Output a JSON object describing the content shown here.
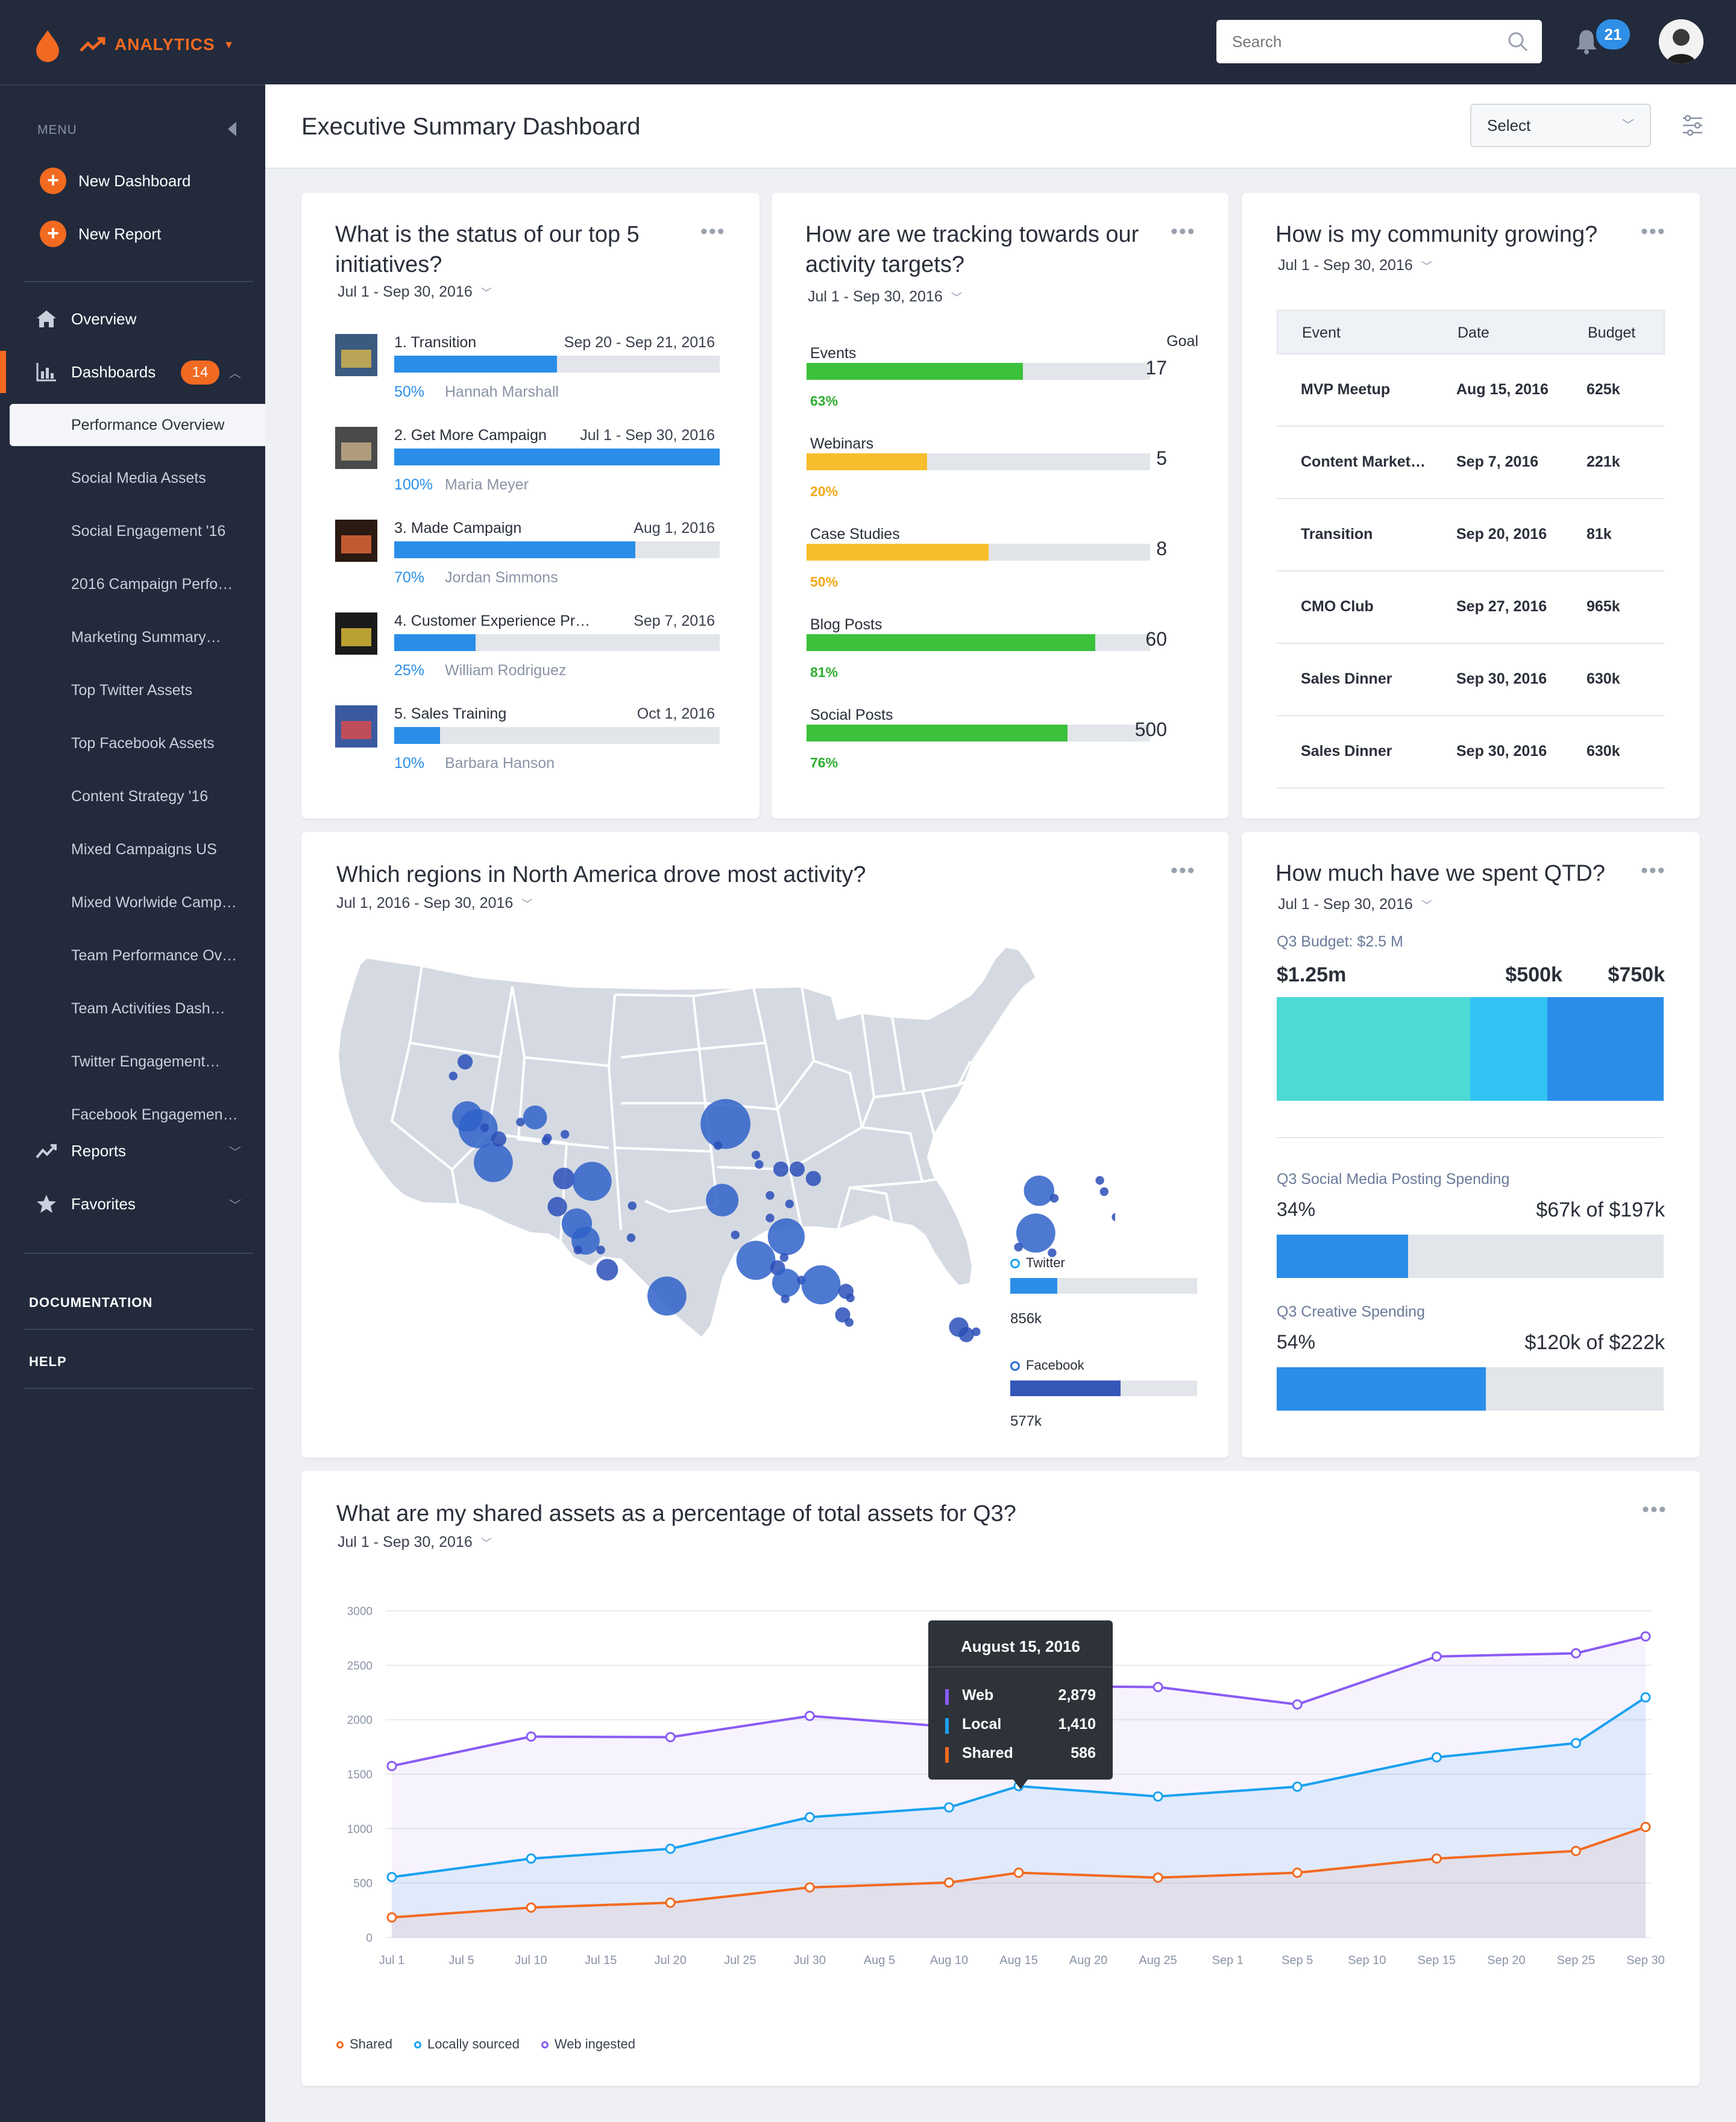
{
  "topbar": {
    "app_name": "ANALYTICS",
    "search": {
      "placeholder": "Search"
    },
    "notifications": "21"
  },
  "sidebar": {
    "menu_label": "MENU",
    "actions": [
      "New Dashboard",
      "New Report"
    ],
    "items": [
      {
        "label": "Overview",
        "icon": "home-icon"
      },
      {
        "label": "Dashboards",
        "icon": "bar-chart-icon",
        "badge": "14",
        "expanded": true
      },
      {
        "label": "Reports",
        "icon": "trend-icon"
      },
      {
        "label": "Favorites",
        "icon": "star-icon"
      }
    ],
    "dashboards": [
      "Performance Overview",
      "Social Media Assets",
      "Social Engagement '16",
      "2016 Campaign Perfo…",
      "Marketing Summary…",
      "Top Twitter Assets",
      "Top Facebook Assets",
      "Content Strategy '16",
      "Mixed Campaigns US",
      "Mixed Worlwide Camp…",
      "Team Performance Ov…",
      "Team Activities Dash…",
      "Twitter Engagement…",
      "Facebook Engagemen…"
    ],
    "sections": [
      "DOCUMENTATION",
      "HELP"
    ]
  },
  "header": {
    "title": "Executive Summary Dashboard",
    "select": "Select"
  },
  "initiatives": {
    "title": "What is the status of our top 5 initiatives?",
    "date": "Jul 1 - Sep 30, 2016",
    "rows": [
      {
        "name": "1. Transition",
        "date": "Sep 20 - Sep 21, 2016",
        "pct": "50%",
        "value": 0.5,
        "owner": "Hannah Marshall"
      },
      {
        "name": "2. Get More Campaign",
        "date": "Jul 1 - Sep 30, 2016",
        "pct": "100%",
        "value": 1.0,
        "owner": "Maria Meyer"
      },
      {
        "name": "3. Made Campaign",
        "date": "Aug 1, 2016",
        "pct": "70%",
        "value": 0.74,
        "owner": "Jordan Simmons"
      },
      {
        "name": "4. Customer Experience Pr…",
        "date": "Sep 7, 2016",
        "pct": "25%",
        "value": 0.25,
        "owner": "William Rodriguez"
      },
      {
        "name": "5. Sales Training",
        "date": "Oct 1, 2016",
        "pct": "10%",
        "value": 0.14,
        "owner": "Barbara Hanson"
      }
    ]
  },
  "activity": {
    "title": "How are we tracking towards our activity targets?",
    "date": "Jul 1 - Sep 30, 2016",
    "goal_label": "Goal",
    "rows": [
      {
        "name": "Events",
        "pct": "63%",
        "value": 0.63,
        "goal": "17",
        "color": "#3cc13c"
      },
      {
        "name": "Webinars",
        "pct": "20%",
        "value": 0.35,
        "goal": "5",
        "color": "#f7bd2c"
      },
      {
        "name": "Case Studies",
        "pct": "50%",
        "value": 0.53,
        "goal": "8",
        "color": "#f7bd2c"
      },
      {
        "name": "Blog Posts",
        "pct": "81%",
        "value": 0.84,
        "goal": "60",
        "color": "#3cc13c"
      },
      {
        "name": "Social Posts",
        "pct": "76%",
        "value": 0.76,
        "goal": "500",
        "color": "#3cc13c"
      }
    ]
  },
  "community": {
    "title": "How is my community growing?",
    "date": "Jul 1 - Sep 30, 2016",
    "columns": [
      "Event",
      "Date",
      "Budget"
    ],
    "rows": [
      [
        "MVP Meetup",
        "Aug 15, 2016",
        "625k"
      ],
      [
        "Content Market…",
        "Sep 7, 2016",
        "221k"
      ],
      [
        "Transition",
        "Sep 20, 2016",
        "81k"
      ],
      [
        "CMO Club",
        "Sep 27, 2016",
        "965k"
      ],
      [
        "Sales Dinner",
        "Sep 30, 2016",
        "630k"
      ],
      [
        "Sales Dinner",
        "Sep 30, 2016",
        "630k"
      ]
    ]
  },
  "regions": {
    "title": "Which regions in North America drove most activity?",
    "date": "Jul 1, 2016 - Sep 30, 2016",
    "legend": [
      {
        "name": "Twitter",
        "value": "856k",
        "fill": 0.25,
        "color": "#2a8ee8"
      },
      {
        "name": "Facebook",
        "value": "577k",
        "fill": 0.59,
        "color": "#3557b8"
      }
    ]
  },
  "spent": {
    "title": "How much have we spent QTD?",
    "date": "Jul 1 - Sep 30, 2016",
    "budget_label": "Q3 Budget: $2.5 M",
    "segments": [
      {
        "label": "$1.25m",
        "value": 1.25,
        "color": "#4dd9d4"
      },
      {
        "label": "$500k",
        "value": 0.5,
        "color": "#31c4f3"
      },
      {
        "label": "$750k",
        "value": 0.75,
        "color": "#2a8ee8"
      }
    ],
    "social": {
      "label": "Q3 Social Media Posting Spending",
      "pct": "34%",
      "amount": "$67k of $197k",
      "value": 0.34
    },
    "creative": {
      "label": "Q3 Creative Spending",
      "pct": "54%",
      "amount": "$120k of $222k",
      "value": 0.54
    }
  },
  "assets": {
    "title": "What are my shared assets as a percentage of total assets for Q3?",
    "date": "Jul 1 - Sep 30, 2016",
    "tooltip": {
      "date": "August 15, 2016",
      "rows": [
        {
          "name": "Web",
          "value": "2,879",
          "color": "#8a5cf5"
        },
        {
          "name": "Local",
          "value": "1,410",
          "color": "#1aa1f0"
        },
        {
          "name": "Shared",
          "value": "586",
          "color": "#f26a21"
        }
      ]
    }
  },
  "chart_data": {
    "type": "area",
    "title": "What are my shared assets as a percentage of total assets for Q3?",
    "x": [
      "Jul 1",
      "Jul 5",
      "Jul 10",
      "Jul 15",
      "Jul 20",
      "Jul 25",
      "Jul 30",
      "Aug 5",
      "Aug 10",
      "Aug 15",
      "Aug 20",
      "Aug 25",
      "Sep 1",
      "Sep 5",
      "Sep 10",
      "Sep 15",
      "Sep 20",
      "Sep 25",
      "Sep 30"
    ],
    "ylim": [
      0,
      3000
    ],
    "yticks": [
      0,
      500,
      1000,
      1500,
      2000,
      2500,
      3000
    ],
    "grid": true,
    "legend_position": "bottom-left",
    "series": [
      {
        "name": "Shared",
        "color": "#f26a21",
        "points": [
          [
            "Jul 1",
            185
          ],
          [
            "Jul 10",
            275
          ],
          [
            "Jul 20",
            320
          ],
          [
            "Jul 30",
            460
          ],
          [
            "Aug 10",
            505
          ],
          [
            "Aug 15",
            595
          ],
          [
            "Aug 25",
            550
          ],
          [
            "Sep 5",
            595
          ],
          [
            "Sep 15",
            725
          ],
          [
            "Sep 25",
            795
          ],
          [
            "Sep 30",
            1015
          ]
        ]
      },
      {
        "name": "Locally sourced",
        "color": "#1aa1f0",
        "points": [
          [
            "Jul 1",
            555
          ],
          [
            "Jul 10",
            725
          ],
          [
            "Jul 20",
            815
          ],
          [
            "Jul 30",
            1105
          ],
          [
            "Aug 10",
            1195
          ],
          [
            "Aug 15",
            1390
          ],
          [
            "Aug 25",
            1295
          ],
          [
            "Sep 5",
            1385
          ],
          [
            "Sep 15",
            1655
          ],
          [
            "Sep 25",
            1785
          ],
          [
            "Sep 30",
            2205
          ]
        ]
      },
      {
        "name": "Web ingested",
        "color": "#8a5cf5",
        "points": [
          [
            "Jul 1",
            1575
          ],
          [
            "Jul 10",
            1845
          ],
          [
            "Jul 20",
            1840
          ],
          [
            "Jul 30",
            2035
          ],
          [
            "Aug 10",
            1935
          ],
          [
            "Aug 15",
            2310
          ],
          [
            "Aug 25",
            2300
          ],
          [
            "Sep 5",
            2140
          ],
          [
            "Sep 15",
            2580
          ],
          [
            "Sep 25",
            2610
          ],
          [
            "Sep 30",
            2765
          ]
        ]
      }
    ]
  }
}
